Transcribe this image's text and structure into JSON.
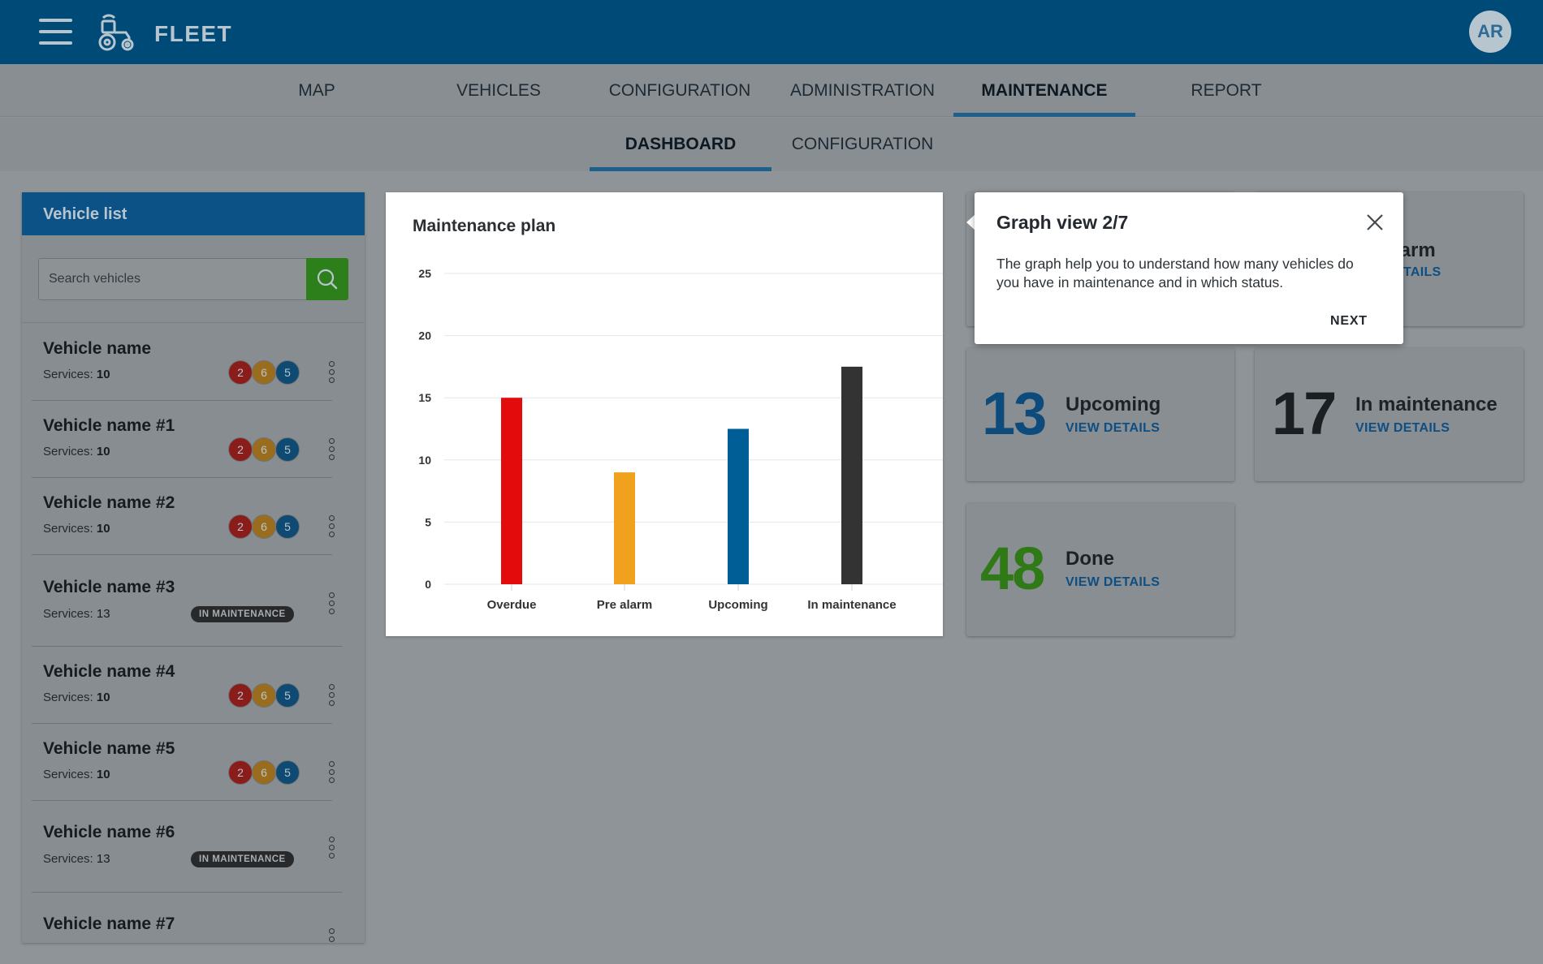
{
  "app": {
    "title": "FLEET",
    "avatar_initials": "AR"
  },
  "main_nav": [
    "MAP",
    "VEHICLES",
    "CONFIGURATION",
    "ADMINISTRATION",
    "MAINTENANCE",
    "REPORT"
  ],
  "main_nav_active": "MAINTENANCE",
  "sub_nav": [
    "DASHBOARD",
    "CONFIGURATION"
  ],
  "sub_nav_active": "DASHBOARD",
  "vehicle_list": {
    "title": "Vehicle list",
    "search_placeholder": "Search vehicles",
    "services_label": "Services:",
    "maintenance_pill": "IN MAINTENANCE",
    "items": [
      {
        "name": "Vehicle name",
        "services": "10",
        "counts": [
          "2",
          "6",
          "5"
        ]
      },
      {
        "name": "Vehicle name #1",
        "services": "10",
        "counts": [
          "2",
          "6",
          "5"
        ]
      },
      {
        "name": "Vehicle name #2",
        "services": "10",
        "counts": [
          "2",
          "6",
          "5"
        ]
      },
      {
        "name": "Vehicle name #3",
        "services": "13",
        "in_maintenance": true
      },
      {
        "name": "Vehicle name #4",
        "services": "10",
        "counts": [
          "2",
          "6",
          "5"
        ]
      },
      {
        "name": "Vehicle name #5",
        "services": "10",
        "counts": [
          "2",
          "6",
          "5"
        ]
      },
      {
        "name": "Vehicle name #6",
        "services": "13",
        "in_maintenance": true
      },
      {
        "name": "Vehicle name #7"
      }
    ]
  },
  "chart_card": {
    "title": "Maintenance plan"
  },
  "chart_data": {
    "type": "bar",
    "categories": [
      "Overdue",
      "Pre alarm",
      "Upcoming",
      "In maintenance"
    ],
    "values": [
      15,
      9,
      12.5,
      17.5
    ],
    "colors": [
      "#e30b0b",
      "#f0a21e",
      "#005e96",
      "#333333"
    ],
    "ylim": [
      0,
      25
    ],
    "yticks": [
      0,
      5,
      10,
      15,
      20,
      25
    ],
    "grid": true
  },
  "stats": {
    "pre_alarm": {
      "label_partial": "larm",
      "link_partial": "ETAILS"
    },
    "upcoming": {
      "value": "13",
      "label": "Upcoming",
      "link": "VIEW DETAILS",
      "color": "#0d4b7c"
    },
    "in_maintenance": {
      "value": "17",
      "label": "In maintenance",
      "link": "VIEW DETAILS",
      "color": "#1b1f22"
    },
    "done": {
      "value": "48",
      "label": "Done",
      "link": "VIEW DETAILS",
      "color": "#2f7a17"
    }
  },
  "tooltip": {
    "title": "Graph view 2/7",
    "body": "The graph help you to understand how many vehicles do you have in maintenance and in which status.",
    "next": "NEXT"
  }
}
